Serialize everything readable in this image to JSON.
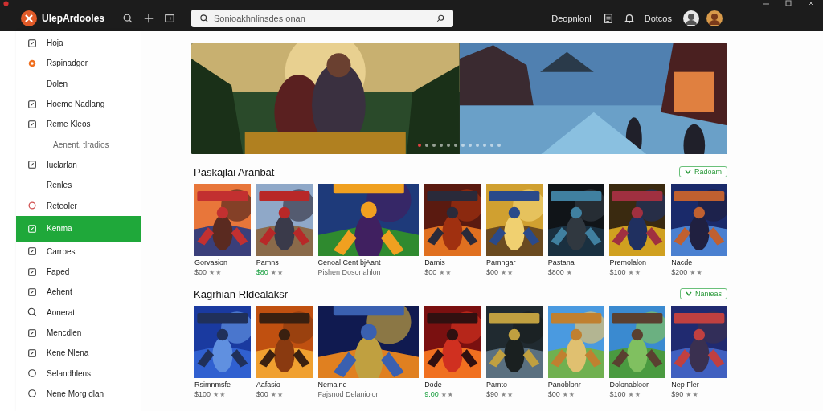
{
  "app": {
    "name": "UlepArdooles"
  },
  "search": {
    "placeholder": "Sonioakhnlinsdes onan"
  },
  "header_links": [
    {
      "label": "Deopnlonl"
    },
    {
      "label": "Dotcos"
    }
  ],
  "sidebar": {
    "items": [
      {
        "label": "Hoja",
        "kind": "icon",
        "selected": false
      },
      {
        "label": "Rspinadger",
        "kind": "icon",
        "selected": false
      },
      {
        "label": "Dolen",
        "kind": "plain",
        "selected": false
      },
      {
        "label": "Hoeme Nadlang",
        "kind": "icon",
        "selected": false
      },
      {
        "label": "Reme Kleos",
        "kind": "icon",
        "selected": false
      },
      {
        "label": "Aenent. tlradios",
        "kind": "note",
        "selected": false
      },
      {
        "label": "Iuclarlan",
        "kind": "icon",
        "selected": false
      },
      {
        "label": "Renles",
        "kind": "plain",
        "selected": false
      },
      {
        "label": "Reteoler",
        "kind": "icon",
        "selected": false
      },
      {
        "label": "Kenma",
        "kind": "icon",
        "selected": true
      },
      {
        "label": "Carroes",
        "kind": "icon",
        "selected": false
      },
      {
        "label": "Faped",
        "kind": "icon",
        "selected": false
      },
      {
        "label": "Aehent",
        "kind": "icon",
        "selected": false
      },
      {
        "label": "Aonerat",
        "kind": "icon",
        "selected": false
      },
      {
        "label": "Mencdlen",
        "kind": "icon",
        "selected": false
      },
      {
        "label": "Kene Nlena",
        "kind": "icon",
        "selected": false
      },
      {
        "label": "Selandhlens",
        "kind": "icon",
        "selected": false
      },
      {
        "label": "Nene Morg dlan",
        "kind": "icon",
        "selected": false
      }
    ]
  },
  "banner": {
    "dots": [
      {
        "selected": true
      },
      {
        "selected": false
      },
      {
        "selected": false
      },
      {
        "selected": false
      },
      {
        "selected": false
      },
      {
        "selected": false
      },
      {
        "selected": false
      },
      {
        "selected": false
      },
      {
        "selected": false
      },
      {
        "selected": false
      },
      {
        "selected": false
      },
      {
        "selected": false
      }
    ]
  },
  "sections": [
    {
      "title": "Paskajlai Aranbat",
      "action": "Radoam",
      "games": [
        {
          "kind": "normal",
          "name": "Gorvasion",
          "price": "$00",
          "sale": false,
          "rating": "★★"
        },
        {
          "kind": "normal",
          "name": "Pamns",
          "price": "$80",
          "sale": true,
          "rating": "★★"
        },
        {
          "kind": "wide",
          "name": "Cenoal Cent bjAant",
          "subtitle": "Pishen Dosonahlon"
        },
        {
          "kind": "normal",
          "name": "Damis",
          "price": "$00",
          "sale": false,
          "rating": "★★"
        },
        {
          "kind": "normal",
          "name": "Pamngar",
          "price": "$00",
          "sale": false,
          "rating": "★★"
        },
        {
          "kind": "normal",
          "name": "Pastana",
          "price": "$800",
          "sale": false,
          "rating": "★"
        },
        {
          "kind": "normal",
          "name": "Premolalon",
          "price": "$100",
          "sale": false,
          "rating": "★★"
        },
        {
          "kind": "normal",
          "name": "Nacde",
          "price": "$200",
          "sale": false,
          "rating": "★★"
        }
      ]
    },
    {
      "title": "Kagrhian Rldealaksr",
      "action": "Nanieas",
      "games": [
        {
          "kind": "normal",
          "name": "Rsimnmsfe",
          "price": "$100",
          "sale": false,
          "rating": "★★"
        },
        {
          "kind": "normal",
          "name": "Aafasio",
          "price": "$00",
          "sale": false,
          "rating": "★★"
        },
        {
          "kind": "wide",
          "name": "Nemaine",
          "subtitle": "Fajsnod Delaniolon"
        },
        {
          "kind": "normal",
          "name": "Dode",
          "price": "9.00",
          "sale": true,
          "rating": "★★"
        },
        {
          "kind": "normal",
          "name": "Pamto",
          "price": "$90",
          "sale": false,
          "rating": "★★"
        },
        {
          "kind": "normal",
          "name": "Panoblonr",
          "price": "$00",
          "sale": false,
          "rating": "★★"
        },
        {
          "kind": "normal",
          "name": "Dolonabloor",
          "price": "$100",
          "sale": false,
          "rating": "★★"
        },
        {
          "kind": "normal",
          "name": "Nep Fler",
          "price": "$90",
          "sale": false,
          "rating": "★★"
        }
      ]
    }
  ]
}
